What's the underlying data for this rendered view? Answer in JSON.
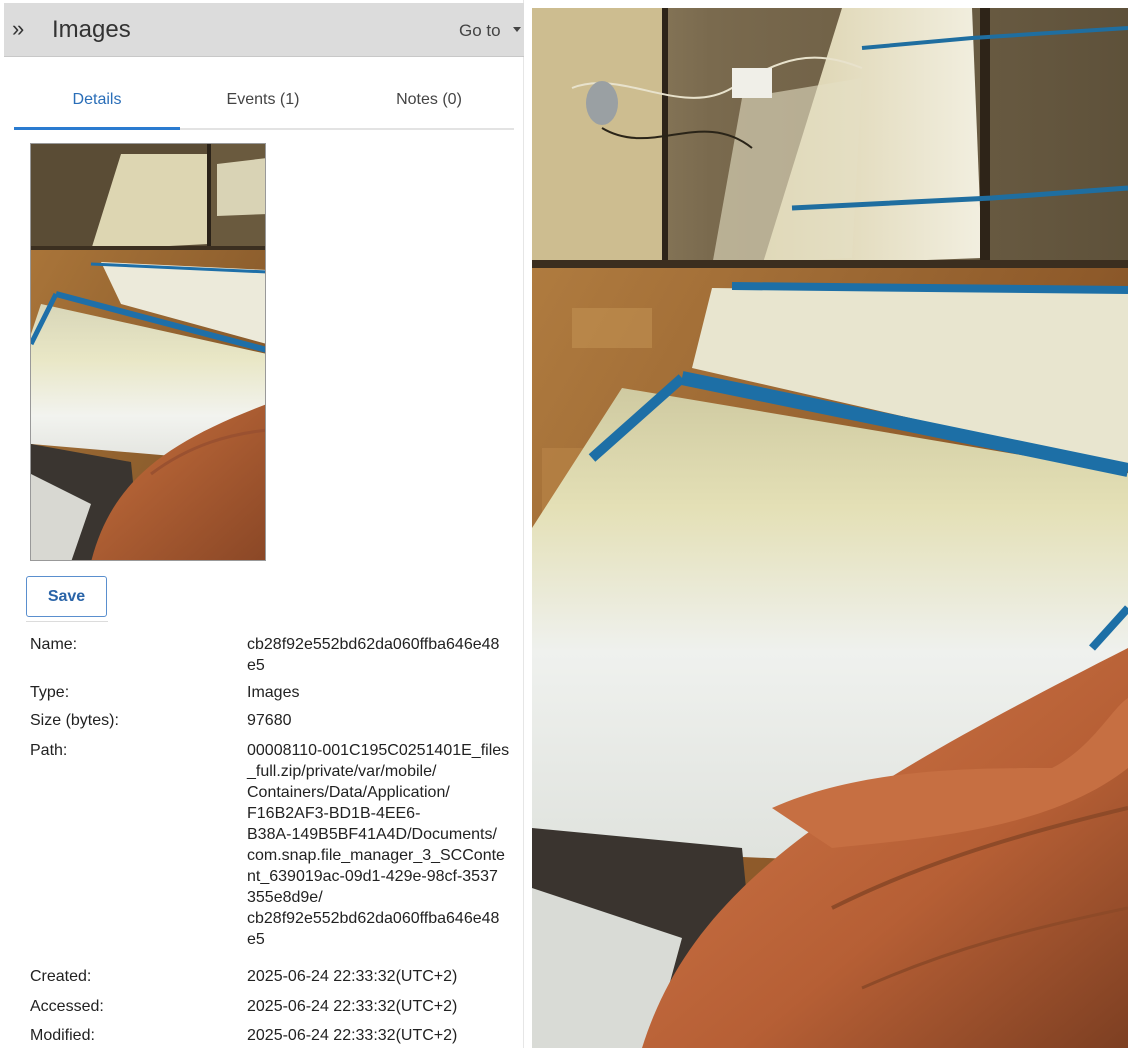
{
  "header": {
    "title": "Images",
    "expand_icon": "double-chevron-right-icon",
    "goto_label": "Go to"
  },
  "tabs": [
    {
      "label": "Details",
      "active": true
    },
    {
      "label": "Events (1)",
      "active": false
    },
    {
      "label": "Notes (0)",
      "active": false
    }
  ],
  "actions": {
    "save_label": "Save"
  },
  "details": {
    "name_label": "Name:",
    "name_lines": [
      "cb28f92e552bd62da060ffba646e48",
      "e5"
    ],
    "type_label": "Type:",
    "type_value": "Images",
    "size_label": "Size (bytes):",
    "size_value": "97680",
    "path_label": "Path:",
    "path_lines": [
      "00008110-001C195C0251401E_files",
      "_full.zip/private/var/mobile/",
      "Containers/Data/Application/",
      "F16B2AF3-BD1B-4EE6-",
      "B38A-149B5BF41A4D/Documents/",
      "com.snap.file_manager_3_SCConte",
      "nt_639019ac-09d1-429e-98cf-3537",
      "355e8d9e/",
      "cb28f92e552bd62da060ffba646e48",
      "e5"
    ],
    "created_label": "Created:",
    "created_value": "2025-06-24 22:33:32(UTC+2)",
    "accessed_label": "Accessed:",
    "accessed_value": "2025-06-24 22:33:32(UTC+2)",
    "modified_label": "Modified:",
    "modified_value": "2025-06-24 22:33:32(UTC+2)"
  },
  "colors": {
    "accent": "#2a7bd0",
    "header_bg": "#dcdcdc"
  }
}
